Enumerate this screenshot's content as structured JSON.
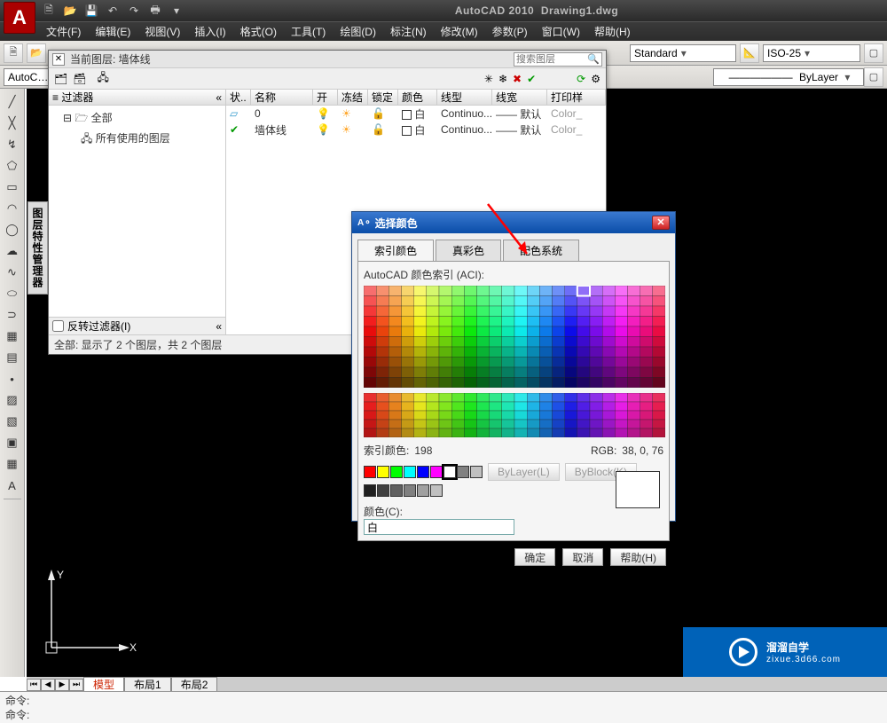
{
  "app": {
    "title": "AutoCAD 2010",
    "doc": "Drawing1.dwg"
  },
  "menus": [
    "文件(F)",
    "编辑(E)",
    "视图(V)",
    "插入(I)",
    "格式(O)",
    "工具(T)",
    "绘图(D)",
    "标注(N)",
    "修改(M)",
    "参数(P)",
    "窗口(W)",
    "帮助(H)"
  ],
  "subbar": {
    "label": "AutoC…"
  },
  "style_combo": "Standard",
  "dim_combo": "ISO-25",
  "bylayer_combo": "ByLayer",
  "layer_panel": {
    "side_title": "图层特性管理器",
    "current": "当前图层: 墙体线",
    "search_ph": "搜索图层",
    "filter_hdr": "过滤器",
    "tree_root": "全部",
    "tree_child": "所有使用的图层",
    "invert": "反转过滤器(I)",
    "cols": {
      "state": "状..",
      "name": "名称",
      "on": "开",
      "freeze": "冻结",
      "lock": "锁定",
      "color": "颜色",
      "ltype": "线型",
      "lweight": "线宽",
      "pstyle": "打印样"
    },
    "rows": [
      {
        "name": "0",
        "color": "白",
        "ltype": "Continuo...",
        "lweight": "—— 默认",
        "pstyle": "Color_"
      },
      {
        "name": "墙体线",
        "color": "白",
        "ltype": "Continuo...",
        "lweight": "—— 默认",
        "pstyle": "Color_"
      }
    ],
    "footer": "全部: 显示了 2 个图层，共 2 个图层"
  },
  "color_dlg": {
    "title": "选择颜色",
    "tabs": [
      "索引颜色",
      "真彩色",
      "配色系统"
    ],
    "aci_label": "AutoCAD 颜色索引 (ACI):",
    "index_label": "索引颜色:",
    "index_value": "198",
    "rgb_label": "RGB:",
    "rgb_value": "38, 0, 76",
    "bylayer_btn": "ByLayer(L)",
    "byblock_btn": "ByBlock(K)",
    "color_lbl": "颜色(C):",
    "color_val": "白",
    "ok": "确定",
    "cancel": "取消",
    "help": "帮助(H)",
    "std_colors": [
      "#ff0000",
      "#ffff00",
      "#00ff00",
      "#00ffff",
      "#0000ff",
      "#ff00ff",
      "#ffffff",
      "#808080",
      "#c0c0c0"
    ],
    "grays": [
      "#202020",
      "#404040",
      "#606060",
      "#808080",
      "#a0a0a0",
      "#c0c0c0"
    ]
  },
  "tabs": {
    "model": "模型",
    "layout1": "布局1",
    "layout2": "布局2"
  },
  "cmd": {
    "prompt": "命令:"
  },
  "watermark": {
    "text": "溜溜自学",
    "sub": "zixue.3d66.com"
  },
  "axis": {
    "x": "X",
    "y": "Y"
  }
}
